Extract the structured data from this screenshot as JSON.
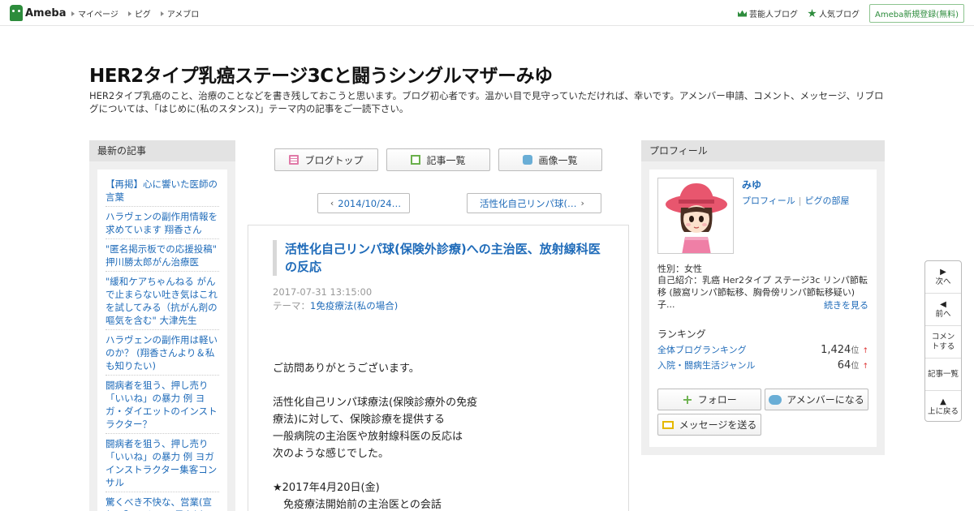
{
  "topbar": {
    "logo": "Ameba",
    "nav": [
      "マイページ",
      "ピグ",
      "アメブロ"
    ],
    "celebrity_blog": "芸能人ブログ",
    "popular_blog": "人気ブログ",
    "register": "Ameba新規登録(無料)"
  },
  "header": {
    "title": "HER2タイプ乳癌ステージ3Cと闘うシングルマザーみゆ",
    "description": "HER2タイプ乳癌のこと、治療のことなどを書き残しておこうと思います。ブログ初心者です。温かい目で見守っていただければ、幸いです。アメンバー申請、コメント、メッセージ、リブログについては、「はじめに(私のスタンス)」テーマ内の記事をご一読下さい。"
  },
  "left_sidebar": {
    "heading": "最新の記事",
    "items": [
      "【再掲】心に響いた医師の言葉",
      "ハラヴェンの副作用情報を求めています 翔香さん",
      "\"匿名掲示板での応援投稿\" 押川勝太郎がん治療医",
      "\"緩和ケアちゃんねる がんで止まらない吐き気はこれを試してみる（抗がん剤の嘔気を含む\" 大津先生",
      "ハラヴェンの副作用は軽いのか？ (翔香さんより＆私も知りたい)",
      "闘病者を狙う、押し売り「いいね」の暴力 例 ヨガ・ダイエットのインストラクター？",
      "闘病者を狙う、押し売り「いいね」の暴力 例 ヨガインストラクター集客コンサル",
      "驚くべき不快な、営業(宣伝)「いいね」の暴力例"
    ]
  },
  "center": {
    "buttons": {
      "blog_top": "ブログトップ",
      "article_list": "記事一覧",
      "image_list": "画像一覧"
    },
    "pager": {
      "prev": "2014/10/24…",
      "next": "活性化自己リンパ球(…"
    },
    "article": {
      "title": "活性化自己リンパ球(保険外診療)への主治医、放射線科医の反応",
      "date": "2017-07-31 13:15:00",
      "theme_label": "テーマ：",
      "theme": "1免疫療法(私の場合)",
      "body": [
        "ご訪問ありがとうございます。",
        "",
        "活性化自己リンパ球療法(保険診療外の免疫",
        "療法)に対して、保険診療を提供する",
        "一般病院の主治医や放射線科医の反応は",
        "次のような感じでした。",
        "",
        "★2017年4月20日(金)",
        "　免疫療法開始前の主治医との会話"
      ]
    }
  },
  "right_sidebar": {
    "heading": "プロフィール",
    "name": "みゆ",
    "link_profile": "プロフィール",
    "link_pig": "ピグの部屋",
    "sex": "性別：女性",
    "intro": "自己紹介：乳癌 Her2タイプ ステージ3c リンパ節転移 (腋窩リンパ節転移、胸骨傍リンパ節転移疑い) 子...",
    "more": "続きを見る",
    "ranking_heading": "ランキング",
    "rankings": [
      {
        "label": "全体ブログランキング",
        "value": "1,424",
        "unit": "位",
        "arrow": "↑"
      },
      {
        "label": "入院・闘病生活ジャンル",
        "value": "64",
        "unit": "位",
        "arrow": "↑"
      }
    ],
    "follow": "フォロー",
    "amember": "アメンバーになる",
    "message": "メッセージを送る"
  },
  "floatnav": {
    "next": "次へ",
    "prev": "前へ",
    "comment": "コメントする",
    "list": "記事一覧",
    "top": "上に戻る"
  },
  "colors": {
    "brand_green": "#2d8c3c",
    "link_blue": "#1f6bb9"
  }
}
